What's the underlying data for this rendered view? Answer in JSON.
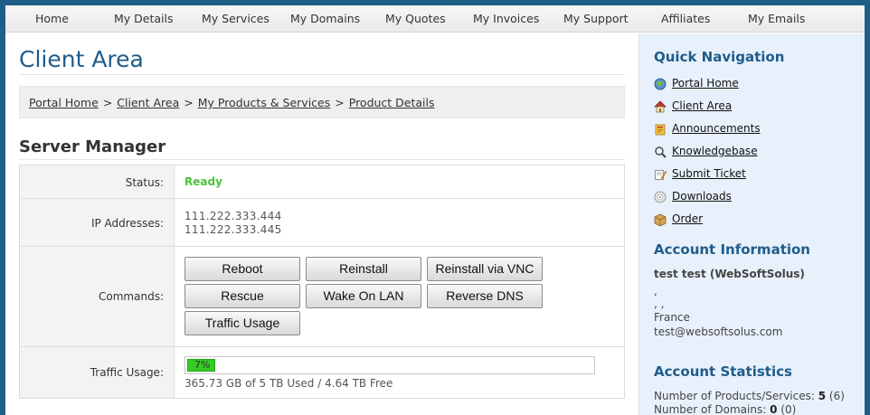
{
  "nav": {
    "items": [
      "Home",
      "My Details",
      "My Services",
      "My Domains",
      "My Quotes",
      "My Invoices",
      "My Support",
      "Affiliates",
      "My Emails"
    ]
  },
  "page": {
    "title": "Client Area",
    "breadcrumb": [
      "Portal Home",
      "Client Area",
      "My Products & Services",
      "Product Details"
    ],
    "breadcrumb_sep": ">"
  },
  "server_manager": {
    "title": "Server Manager",
    "status_label": "Status:",
    "status_value": "Ready",
    "ip_label": "IP Addresses:",
    "ips": [
      "111.222.333.444",
      "111.222.333.445"
    ],
    "commands_label": "Commands:",
    "commands": [
      "Reboot",
      "Reinstall",
      "Reinstall via VNC",
      "Rescue",
      "Wake On LAN",
      "Reverse DNS",
      "Traffic Usage"
    ],
    "traffic_label": "Traffic Usage:",
    "traffic_percent": 7,
    "traffic_percent_text": "7%",
    "traffic_text": "365.73 GB of 5 TB Used / 4.64 TB Free"
  },
  "sidebar": {
    "quick_nav_title": "Quick Navigation",
    "quick_nav": [
      {
        "label": "Portal Home",
        "icon": "globe-icon"
      },
      {
        "label": "Client Area",
        "icon": "home-icon"
      },
      {
        "label": "Announcements",
        "icon": "announcements-icon"
      },
      {
        "label": "Knowledgebase",
        "icon": "knowledgebase-icon"
      },
      {
        "label": "Submit Ticket",
        "icon": "ticket-icon"
      },
      {
        "label": "Downloads",
        "icon": "disc-icon"
      },
      {
        "label": "Order",
        "icon": "box-icon"
      }
    ],
    "account_info_title": "Account Information",
    "account_name": "test test (WebSoftSolus)",
    "account_lines": [
      ",",
      ", ,",
      "France",
      "test@websoftsolus.com"
    ],
    "account_stats_title": "Account Statistics",
    "stats": [
      {
        "label": "Number of Products/Services:",
        "value": "5",
        "extra": "(6)"
      },
      {
        "label": "Number of Domains:",
        "value": "0",
        "extra": "(0)"
      }
    ]
  },
  "colors": {
    "accent": "#1f5c8b",
    "frame": "#1f5f87",
    "ready": "#49c33b",
    "sidebar_bg": "#e8f1fb"
  }
}
